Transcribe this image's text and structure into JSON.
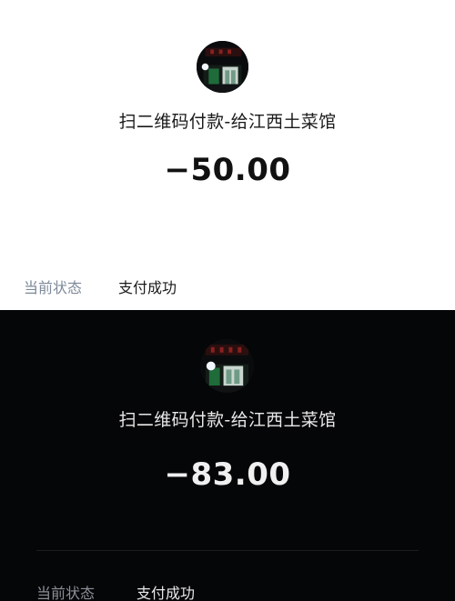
{
  "light": {
    "merchant_title": "扫二维码付款-给江西土菜馆",
    "amount": "−50.00",
    "status_label": "当前状态",
    "status_value": "支付成功"
  },
  "dark": {
    "merchant_title": "扫二维码付款-给江西土菜馆",
    "amount": "−83.00",
    "status_label": "当前状态",
    "status_value": "支付成功"
  },
  "colors": {
    "light_bg": "#ffffff",
    "dark_bg": "#050608",
    "label_gray": "#7e8a99"
  },
  "icons": {
    "avatar": "merchant-avatar-image"
  }
}
